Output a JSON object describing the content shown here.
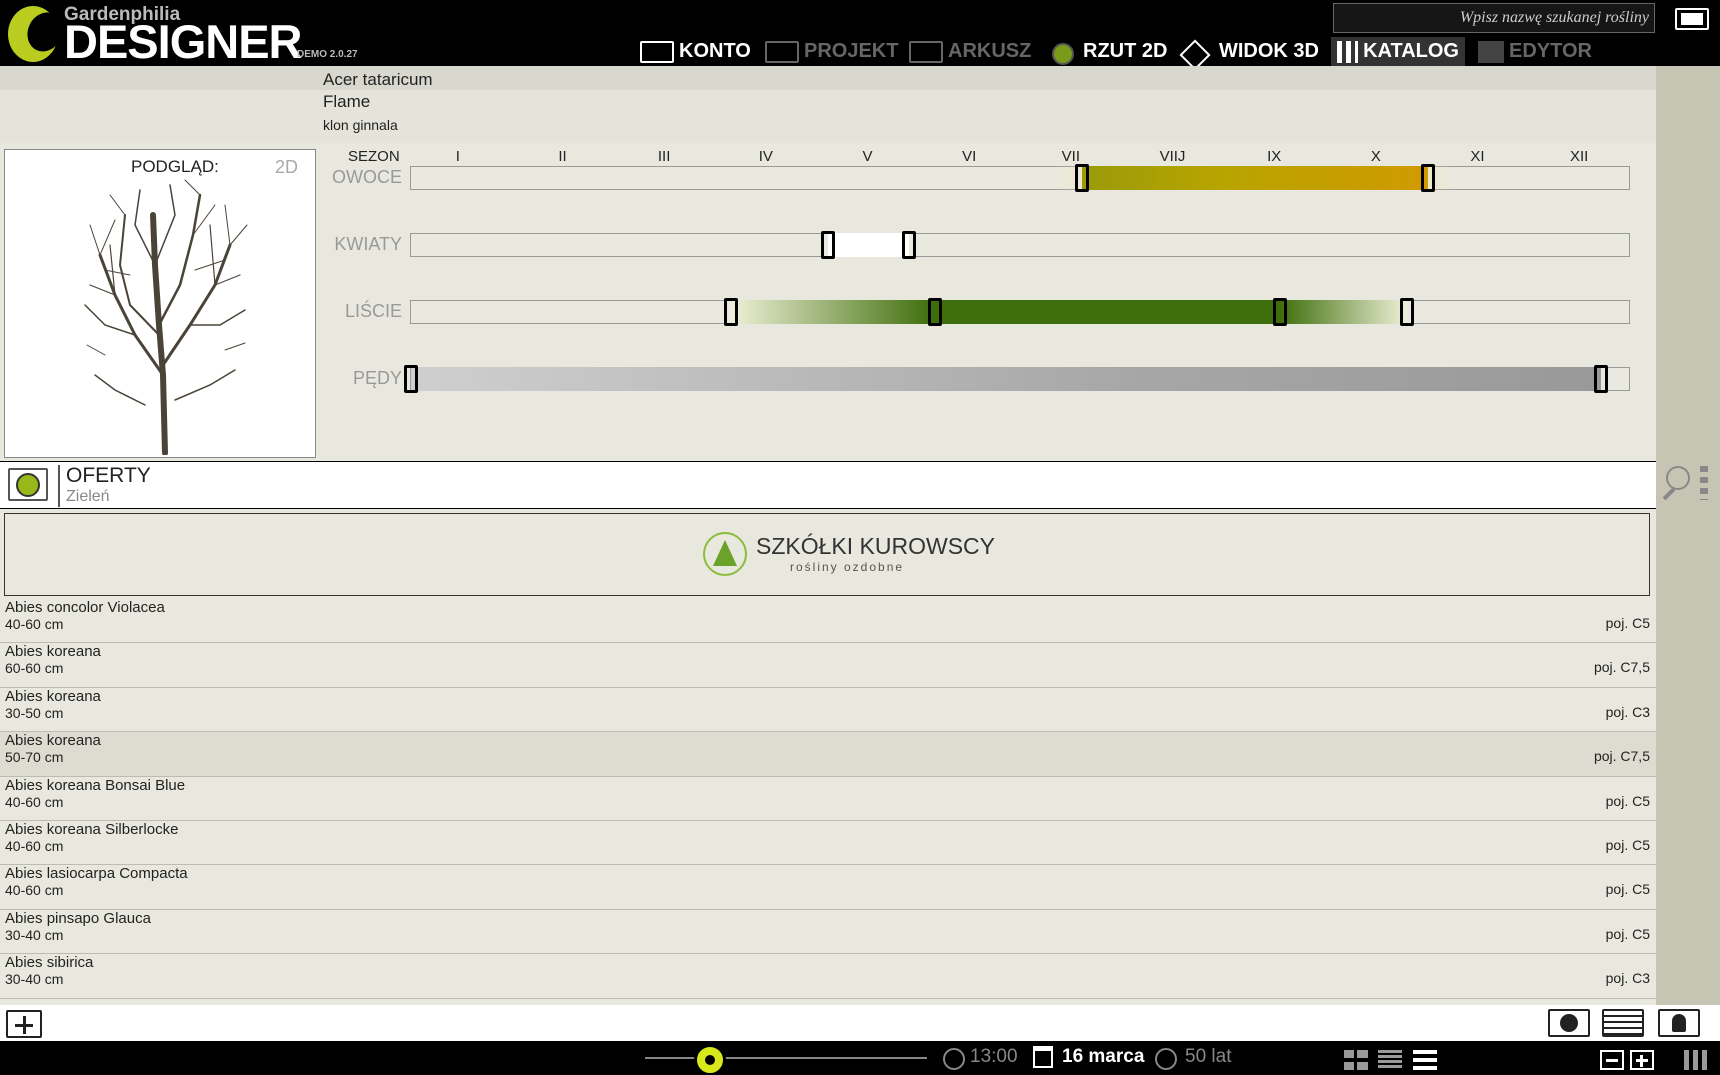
{
  "app": {
    "brand_small": "Gardenphilia",
    "brand_big": "DESIGNER",
    "version": "DEMO 2.0.27"
  },
  "search": {
    "placeholder": "Wpisz nazwę szukanej rośliny"
  },
  "nav": [
    {
      "label": "KONTO",
      "icon": "user-icon",
      "active": true
    },
    {
      "label": "PROJEKT",
      "icon": "project-icon",
      "active": false
    },
    {
      "label": "ARKUSZ",
      "icon": "sheet-icon",
      "active": false
    },
    {
      "label": "RZUT 2D",
      "icon": "plan-2d-icon",
      "active": true
    },
    {
      "label": "WIDOK 3D",
      "icon": "view-3d-icon",
      "active": true
    },
    {
      "label": "KATALOG",
      "icon": "catalog-icon",
      "active": true,
      "selected": true
    },
    {
      "label": "EDYTOR",
      "icon": "editor-icon",
      "active": false
    }
  ],
  "plant": {
    "latin_name": "Acer tataricum",
    "cultivar": "Flame",
    "common_name": "klon ginnala"
  },
  "preview": {
    "label": "PODGLĄD:",
    "mode": "2D"
  },
  "season": {
    "label": "SEZON",
    "months": [
      "I",
      "II",
      "III",
      "IV",
      "V",
      "VI",
      "VII",
      "VIIJ",
      "IX",
      "X",
      "XI",
      "XII"
    ],
    "rows": [
      {
        "key": "owoce",
        "label": "OWOCE",
        "start": 7.1,
        "end": 10.5,
        "color": "#b8a400"
      },
      {
        "key": "kwiaty",
        "label": "KWIATY",
        "start": 4.6,
        "end": 5.4,
        "color": "#ffffff"
      },
      {
        "key": "liscie",
        "label": "LIŚCIE",
        "start": 3.65,
        "end": 10.3,
        "peak_start": 5.65,
        "peak_end": 9.05,
        "color": "#3e6e0b"
      },
      {
        "key": "pedy",
        "label": "PĘDY",
        "start": 0.5,
        "end": 12.2,
        "color": "#a7a7a7"
      }
    ]
  },
  "offers": {
    "title": "OFERTY",
    "subtitle": "Zieleń",
    "vendor": {
      "name": "SZKÓŁKI KUROWSCY",
      "tagline": "rośliny ozdobne"
    },
    "items": [
      {
        "name": "Abies concolor Violacea",
        "size": "40-60 cm",
        "pot": "poj. C5"
      },
      {
        "name": "Abies koreana",
        "size": "60-60 cm",
        "pot": "poj. C7,5"
      },
      {
        "name": "Abies koreana",
        "size": "30-50 cm",
        "pot": "poj. C3"
      },
      {
        "name": "Abies koreana",
        "size": "50-70 cm",
        "pot": "poj. C7,5",
        "selected": true
      },
      {
        "name": "Abies koreana Bonsai Blue",
        "size": "40-60 cm",
        "pot": "poj. C5"
      },
      {
        "name": "Abies koreana Silberlocke",
        "size": "40-60 cm",
        "pot": "poj. C5"
      },
      {
        "name": "Abies lasiocarpa Compacta",
        "size": "40-60 cm",
        "pot": "poj. C5"
      },
      {
        "name": "Abies pinsapo Glauca",
        "size": "30-40 cm",
        "pot": "poj. C5"
      },
      {
        "name": "Abies sibirica",
        "size": "30-40 cm",
        "pot": "poj. C3"
      }
    ]
  },
  "footer": {
    "time": "13:00",
    "date": "16 marca",
    "age": "50 lat",
    "time_slider_fraction": 0.23
  }
}
